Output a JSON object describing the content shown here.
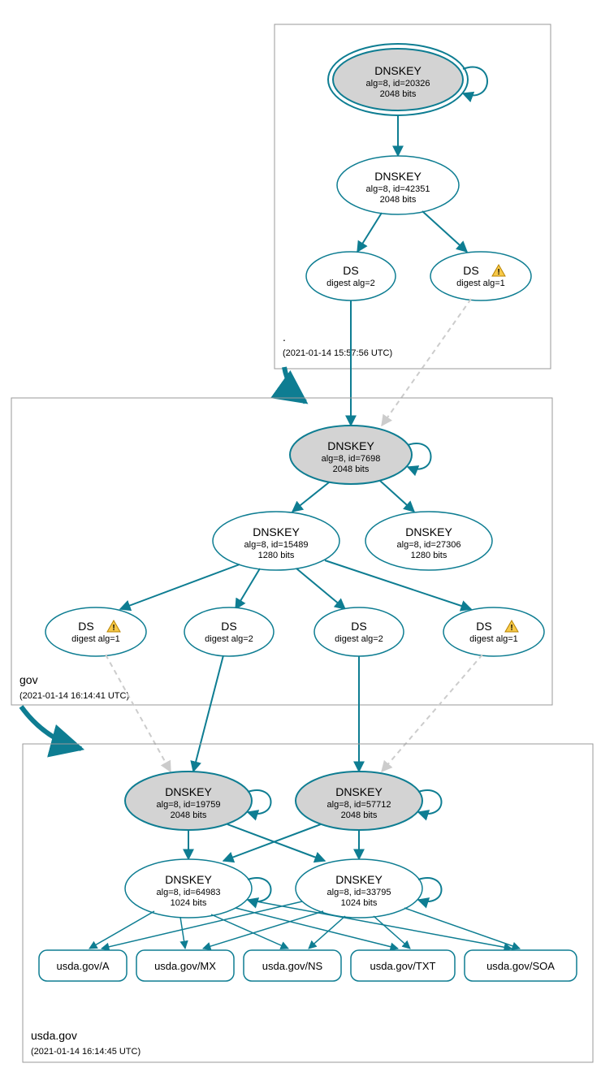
{
  "colors": {
    "teal": "#0e7d92",
    "grayFill": "#d3d3d3",
    "dashedGray": "#cccccc"
  },
  "zones": {
    "root": {
      "label": ".",
      "timestamp": "(2021-01-14 15:57:56 UTC)"
    },
    "gov": {
      "label": "gov",
      "timestamp": "(2021-01-14 16:14:41 UTC)"
    },
    "usda": {
      "label": "usda.gov",
      "timestamp": "(2021-01-14 16:14:45 UTC)"
    }
  },
  "nodes": {
    "root_ksk": {
      "title": "DNSKEY",
      "line2": "alg=8, id=20326",
      "line3": "2048 bits"
    },
    "root_zsk": {
      "title": "DNSKEY",
      "line2": "alg=8, id=42351",
      "line3": "2048 bits"
    },
    "root_ds1": {
      "title": "DS",
      "line2": "digest alg=2"
    },
    "root_ds2": {
      "title": "DS",
      "line2": "digest alg=1"
    },
    "gov_ksk": {
      "title": "DNSKEY",
      "line2": "alg=8, id=7698",
      "line3": "2048 bits"
    },
    "gov_zsk1": {
      "title": "DNSKEY",
      "line2": "alg=8, id=15489",
      "line3": "1280 bits"
    },
    "gov_zsk2": {
      "title": "DNSKEY",
      "line2": "alg=8, id=27306",
      "line3": "1280 bits"
    },
    "gov_ds1": {
      "title": "DS",
      "line2": "digest alg=1"
    },
    "gov_ds2": {
      "title": "DS",
      "line2": "digest alg=2"
    },
    "gov_ds3": {
      "title": "DS",
      "line2": "digest alg=2"
    },
    "gov_ds4": {
      "title": "DS",
      "line2": "digest alg=1"
    },
    "usda_ksk1": {
      "title": "DNSKEY",
      "line2": "alg=8, id=19759",
      "line3": "2048 bits"
    },
    "usda_ksk2": {
      "title": "DNSKEY",
      "line2": "alg=8, id=57712",
      "line3": "2048 bits"
    },
    "usda_zsk1": {
      "title": "DNSKEY",
      "line2": "alg=8, id=64983",
      "line3": "1024 bits"
    },
    "usda_zsk2": {
      "title": "DNSKEY",
      "line2": "alg=8, id=33795",
      "line3": "1024 bits"
    }
  },
  "rrsets": {
    "a": "usda.gov/A",
    "mx": "usda.gov/MX",
    "ns": "usda.gov/NS",
    "txt": "usda.gov/TXT",
    "soa": "usda.gov/SOA"
  }
}
